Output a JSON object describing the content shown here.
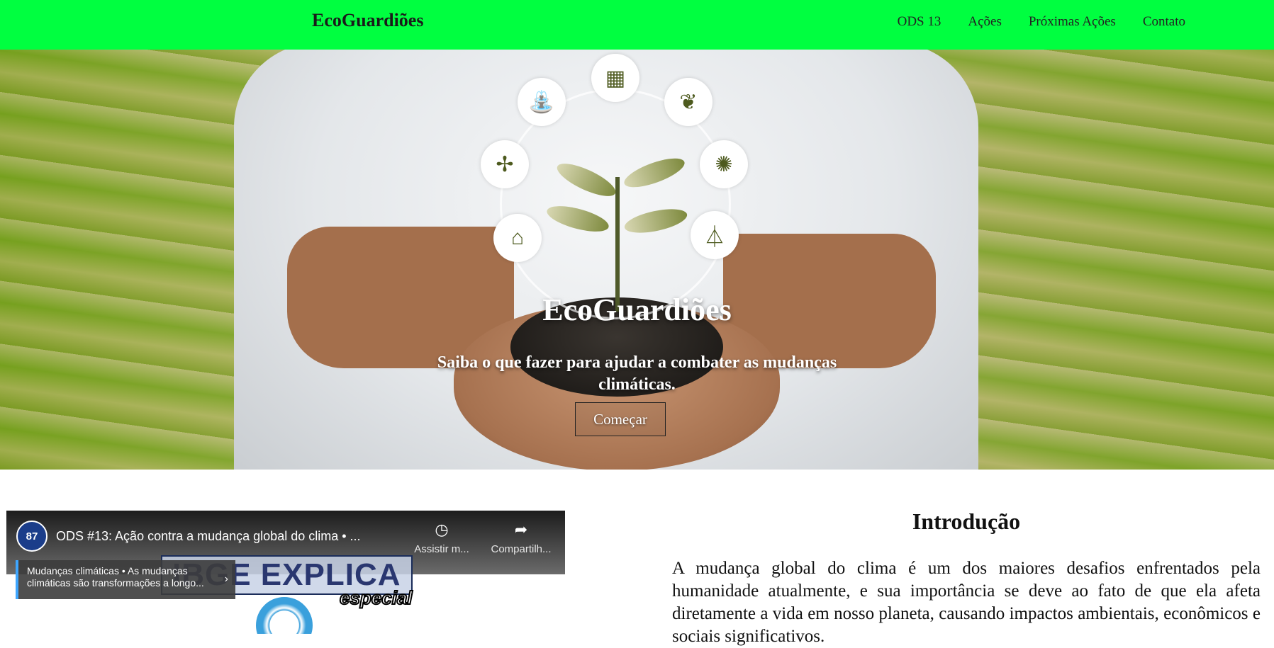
{
  "nav": {
    "brand": "EcoGuardiões",
    "links": [
      "ODS 13",
      "Ações",
      "Próximas Ações",
      "Contato"
    ]
  },
  "hero": {
    "title": "EcoGuardiões",
    "subtitle": "Saiba o que fazer para ajudar a combater as mudanças climáticas.",
    "button": "Começar",
    "icons": [
      "solar-panel-icon",
      "leaf-icon",
      "lightbulb-icon",
      "oil-rig-icon",
      "factory-icon",
      "wind-turbine-icon",
      "water-tap-icon"
    ]
  },
  "video": {
    "channel_badge": "87",
    "title": "ODS #13: Ação contra a mudança global do clima • ...",
    "watch_later": "Assistir m...",
    "share": "Compartilh...",
    "chapter": "Mudanças climáticas • As mudanças climáticas são transformações a longo...",
    "overlay_title": "IBGE EXPLICA",
    "overlay_sub": "especial"
  },
  "intro": {
    "title": "Introdução",
    "text": "A mudança global do clima é um dos maiores desafios enfrentados pela humanidade atualmente, e sua importância se deve ao fato de que ela afeta diretamente a vida em nosso planeta, causando impactos ambientais, econômicos e sociais significativos."
  },
  "colors": {
    "nav_bg": "#00ff40",
    "text_dark": "#111111",
    "hero_text": "#ffffff"
  }
}
